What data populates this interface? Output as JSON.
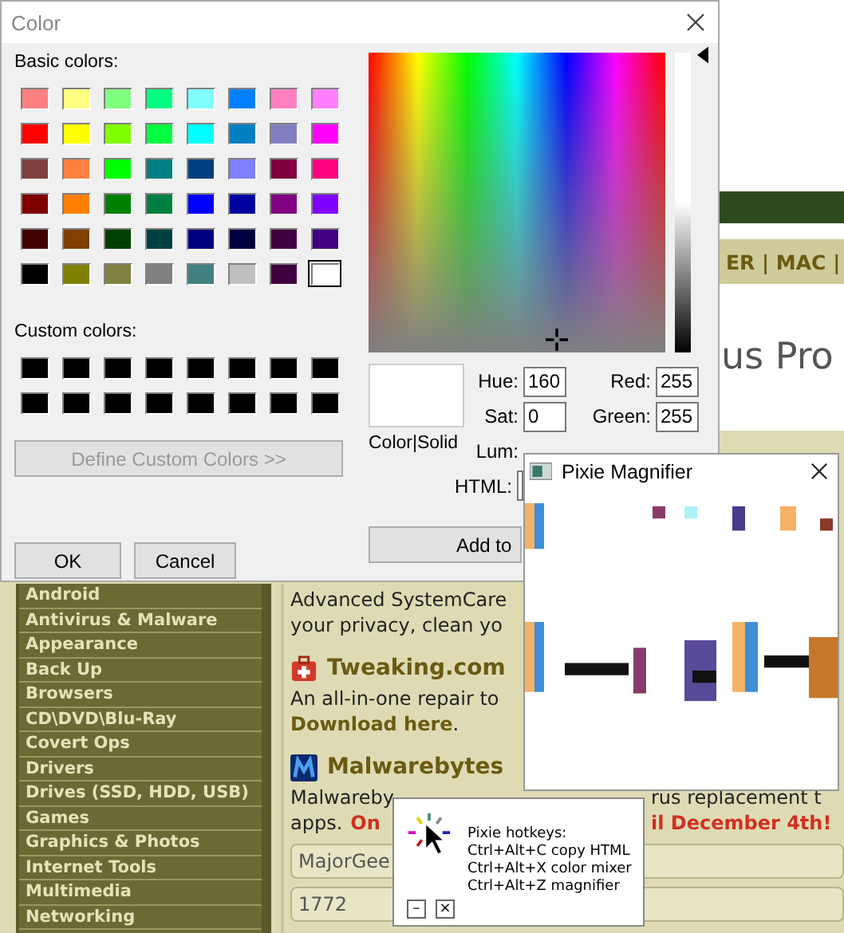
{
  "webpage": {
    "nav": "ER | MAC |",
    "heading": "us Pro",
    "sidebar": [
      "Android",
      "Antivirus & Malware",
      "Appearance",
      "Back Up",
      "Browsers",
      "CD\\DVD\\Blu-Ray",
      "Covert Ops",
      "Drivers",
      "Drives (SSD, HDD, USB)",
      "Games",
      "Graphics & Photos",
      "Internet Tools",
      "Multimedia",
      "Networking"
    ],
    "content": [
      {
        "kind": "text",
        "text": "Advanced SystemCare"
      },
      {
        "kind": "text",
        "text": "your privacy, clean yo"
      },
      {
        "kind": "kitheading",
        "text": "Tweaking.com"
      },
      {
        "kind": "text",
        "text": "An all-in-one repair to"
      },
      {
        "kind": "link",
        "text": "Download here",
        "after": "."
      },
      {
        "kind": "logoheading",
        "text": "Malwarebytes"
      },
      {
        "kind": "split",
        "left": [
          {
            "text": "Malwareby",
            "promo": false
          }
        ],
        "right": [
          {
            "text": "rus replacement t",
            "promo": false
          }
        ]
      },
      {
        "kind": "split",
        "left": [
          {
            "text": "apps.",
            "promo": false
          },
          {
            "text": "On",
            "promo": true
          }
        ],
        "right": [
          {
            "text": "il December 4th!",
            "promo": true
          }
        ]
      },
      {
        "kind": "box",
        "text": "MajorGee"
      },
      {
        "kind": "box",
        "text": "1772"
      }
    ]
  },
  "color_dialog": {
    "title": "Color",
    "basic_colors_label": "Basic colors:",
    "basic_colors": [
      {
        "color": "#ff8080",
        "selected": false
      },
      {
        "color": "#ffff80",
        "selected": false
      },
      {
        "color": "#80ff80",
        "selected": false
      },
      {
        "color": "#00ff80",
        "selected": false
      },
      {
        "color": "#80ffff",
        "selected": false
      },
      {
        "color": "#0080ff",
        "selected": false
      },
      {
        "color": "#ff80c0",
        "selected": false
      },
      {
        "color": "#ff80ff",
        "selected": false
      },
      {
        "color": "#ff0000",
        "selected": false
      },
      {
        "color": "#ffff00",
        "selected": false
      },
      {
        "color": "#80ff00",
        "selected": false
      },
      {
        "color": "#00ff40",
        "selected": false
      },
      {
        "color": "#00ffff",
        "selected": false
      },
      {
        "color": "#0080c0",
        "selected": false
      },
      {
        "color": "#8080c0",
        "selected": false
      },
      {
        "color": "#ff00ff",
        "selected": false
      },
      {
        "color": "#804040",
        "selected": false
      },
      {
        "color": "#ff8040",
        "selected": false
      },
      {
        "color": "#00ff00",
        "selected": false
      },
      {
        "color": "#008080",
        "selected": false
      },
      {
        "color": "#004080",
        "selected": false
      },
      {
        "color": "#8080ff",
        "selected": false
      },
      {
        "color": "#800040",
        "selected": false
      },
      {
        "color": "#ff0080",
        "selected": false
      },
      {
        "color": "#800000",
        "selected": false
      },
      {
        "color": "#ff8000",
        "selected": false
      },
      {
        "color": "#008000",
        "selected": false
      },
      {
        "color": "#008040",
        "selected": false
      },
      {
        "color": "#0000ff",
        "selected": false
      },
      {
        "color": "#0000a0",
        "selected": false
      },
      {
        "color": "#800080",
        "selected": false
      },
      {
        "color": "#8000ff",
        "selected": false
      },
      {
        "color": "#400000",
        "selected": false
      },
      {
        "color": "#804000",
        "selected": false
      },
      {
        "color": "#004000",
        "selected": false
      },
      {
        "color": "#004040",
        "selected": false
      },
      {
        "color": "#000080",
        "selected": false
      },
      {
        "color": "#000040",
        "selected": false
      },
      {
        "color": "#400040",
        "selected": false
      },
      {
        "color": "#400080",
        "selected": false
      },
      {
        "color": "#000000",
        "selected": false
      },
      {
        "color": "#808000",
        "selected": false
      },
      {
        "color": "#808040",
        "selected": false
      },
      {
        "color": "#808080",
        "selected": false
      },
      {
        "color": "#408080",
        "selected": false
      },
      {
        "color": "#c0c0c0",
        "selected": false
      },
      {
        "color": "#400040",
        "selected": false
      },
      {
        "color": "#ffffff",
        "selected": true
      }
    ],
    "custom_colors_label": "Custom colors:",
    "custom_colors": [
      {
        "color": "#000000"
      },
      {
        "color": "#000000"
      },
      {
        "color": "#000000"
      },
      {
        "color": "#000000"
      },
      {
        "color": "#000000"
      },
      {
        "color": "#000000"
      },
      {
        "color": "#000000"
      },
      {
        "color": "#000000"
      },
      {
        "color": "#000000"
      },
      {
        "color": "#000000"
      },
      {
        "color": "#000000"
      },
      {
        "color": "#000000"
      },
      {
        "color": "#000000"
      },
      {
        "color": "#000000"
      },
      {
        "color": "#000000"
      },
      {
        "color": "#000000"
      }
    ],
    "define_button": {
      "label": "Define Custom Colors >>",
      "disabled": true
    },
    "preview_label": "Color|Solid",
    "fields": [
      {
        "label": "Hue:",
        "value": "160"
      },
      {
        "label": "Red:",
        "value": "255"
      },
      {
        "label": "Sat:",
        "value": "0"
      },
      {
        "label": "Green:",
        "value": "255"
      },
      {
        "label": "Lum:"
      }
    ],
    "html_label": "HTML:",
    "ok": "OK",
    "cancel": "Cancel",
    "add_button": "Add to"
  },
  "magnifier": {
    "title": "Pixie Magnifier"
  },
  "hotkeys": {
    "title": "Pixie hotkeys:",
    "lines": [
      "Ctrl+Alt+C copy HTML",
      "Ctrl+Alt+X color mixer",
      "Ctrl+Alt+Z magnifier"
    ],
    "minimize": "–",
    "close": "×"
  }
}
